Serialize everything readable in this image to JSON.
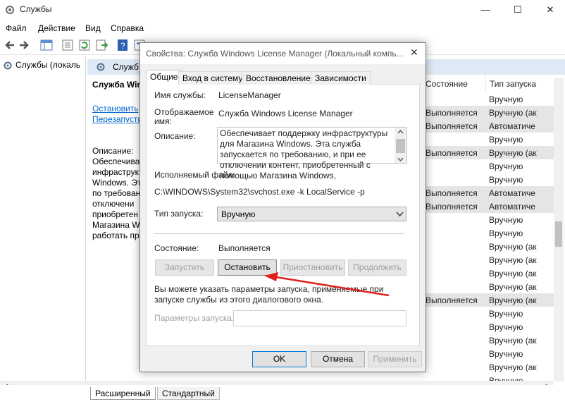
{
  "window": {
    "title": "Службы",
    "minimize": "—",
    "maximize": "☐",
    "close": "✕"
  },
  "menu": [
    "Файл",
    "Действие",
    "Вид",
    "Справка"
  ],
  "tree": {
    "root": "Службы (локаль"
  },
  "services_header": {
    "title": "Служб"
  },
  "detail": {
    "service_name": "Служба Wind",
    "stop_link": "Остановить",
    "restart_link": "Перезапусти",
    "desc_label": "Описание:",
    "desc_lines": [
      "Обеспечива",
      "инфраструкт",
      "Windows. Эт",
      "по требован",
      "отключени",
      "приобретен",
      "Магазина W",
      "работать пр"
    ]
  },
  "table": {
    "headers": {
      "status": "Состояние",
      "startup": "Тип запуска"
    },
    "rows": [
      {
        "status": "",
        "startup": "Вручную"
      },
      {
        "status": "Выполняется",
        "startup": "Вручную (ак"
      },
      {
        "status": "Выполняется",
        "startup": "Автоматиче"
      },
      {
        "status": "",
        "startup": "Вручную"
      },
      {
        "status": "Выполняется",
        "startup": "Вручную (ак"
      },
      {
        "status": "",
        "startup": "Вручную"
      },
      {
        "status": "",
        "startup": "Вручную"
      },
      {
        "status": "Выполняется",
        "startup": "Автоматиче"
      },
      {
        "status": "Выполняется",
        "startup": "Автоматиче"
      },
      {
        "status": "",
        "startup": "Вручную"
      },
      {
        "status": "",
        "startup": "Вручную"
      },
      {
        "status": "",
        "startup": "Вручную (ак"
      },
      {
        "status": "",
        "startup": "Вручную (ак"
      },
      {
        "status": "",
        "startup": "Вручную (ак"
      },
      {
        "status": "",
        "startup": "Вручную (ак"
      },
      {
        "status": "Выполняется",
        "startup": "Вручную (ак"
      },
      {
        "status": "",
        "startup": "Вручную"
      },
      {
        "status": "",
        "startup": "Вручную"
      },
      {
        "status": "",
        "startup": "Вручную (ак"
      },
      {
        "status": "",
        "startup": "Вручную"
      },
      {
        "status": "",
        "startup": "Вручную (ак"
      },
      {
        "status": "",
        "startup": "Вручную"
      }
    ]
  },
  "bottom_tabs": [
    "Расширенный",
    "Стандартный"
  ],
  "dialog": {
    "title": "Свойства: Служба Windows License Manager (Локальный компь...",
    "close": "✕",
    "tabs": [
      "Общие",
      "Вход в систему",
      "Восстановление",
      "Зависимости"
    ],
    "service_name_label": "Имя службы:",
    "service_name": "LicenseManager",
    "display_name_label": "Отображаемое имя:",
    "display_name": "Служба Windows License Manager",
    "description_label": "Описание:",
    "description": "Обеспечивает поддержку инфраструктуры для Магазина Windows. Эта служба запускается по требованию, и при ее отключении контент, приобретенный с помощью Магазина Windows,",
    "exe_label": "Исполняемый файл:",
    "exe_path": "C:\\WINDOWS\\System32\\svchost.exe -k LocalService -p",
    "startup_label": "Тип запуска:",
    "startup_value": "Вручную",
    "state_label": "Состояние:",
    "state_value": "Выполняется",
    "btn_start": "Запустить",
    "btn_stop": "Остановить",
    "btn_pause": "Приостановить",
    "btn_resume": "Продолжить",
    "hint": "Вы можете указать параметры запуска, применяемые при запуске службы из этого диалогового окна.",
    "params_label": "Параметры запуска:",
    "params_value": "",
    "btn_ok": "OK",
    "btn_cancel": "Отмена",
    "btn_apply": "Применить"
  },
  "colors": {
    "annotation_arrow": "#e0201b",
    "link": "#0066cc"
  }
}
